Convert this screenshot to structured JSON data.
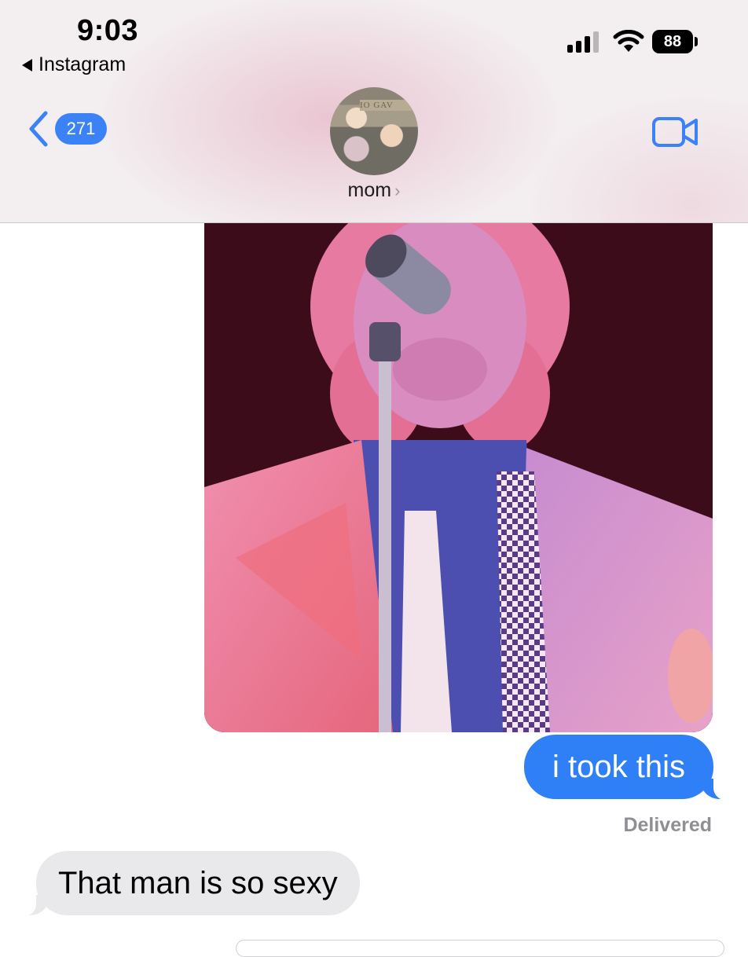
{
  "status_bar": {
    "time": "9:03",
    "back_app": "Instagram",
    "battery": "88",
    "signal_bars_filled": 3,
    "signal_bars_total": 4
  },
  "nav": {
    "unread_count": "271",
    "contact_name": "mom",
    "accent_color": "#3b82f6"
  },
  "avatar": {
    "plaque_text": "IO GAV"
  },
  "messages": [
    {
      "type": "image",
      "direction": "outgoing"
    },
    {
      "type": "text",
      "direction": "outgoing",
      "text": "i took this",
      "color": "#2f80f6"
    },
    {
      "type": "status",
      "text": "Delivered"
    },
    {
      "type": "text",
      "direction": "incoming",
      "text": "That man is so sexy",
      "color": "#e9e9eb"
    }
  ],
  "icons": {
    "back": "chevron-left-icon",
    "video": "video-camera-icon",
    "wifi": "wifi-icon",
    "signal": "cellular-signal-icon",
    "battery": "battery-icon"
  }
}
